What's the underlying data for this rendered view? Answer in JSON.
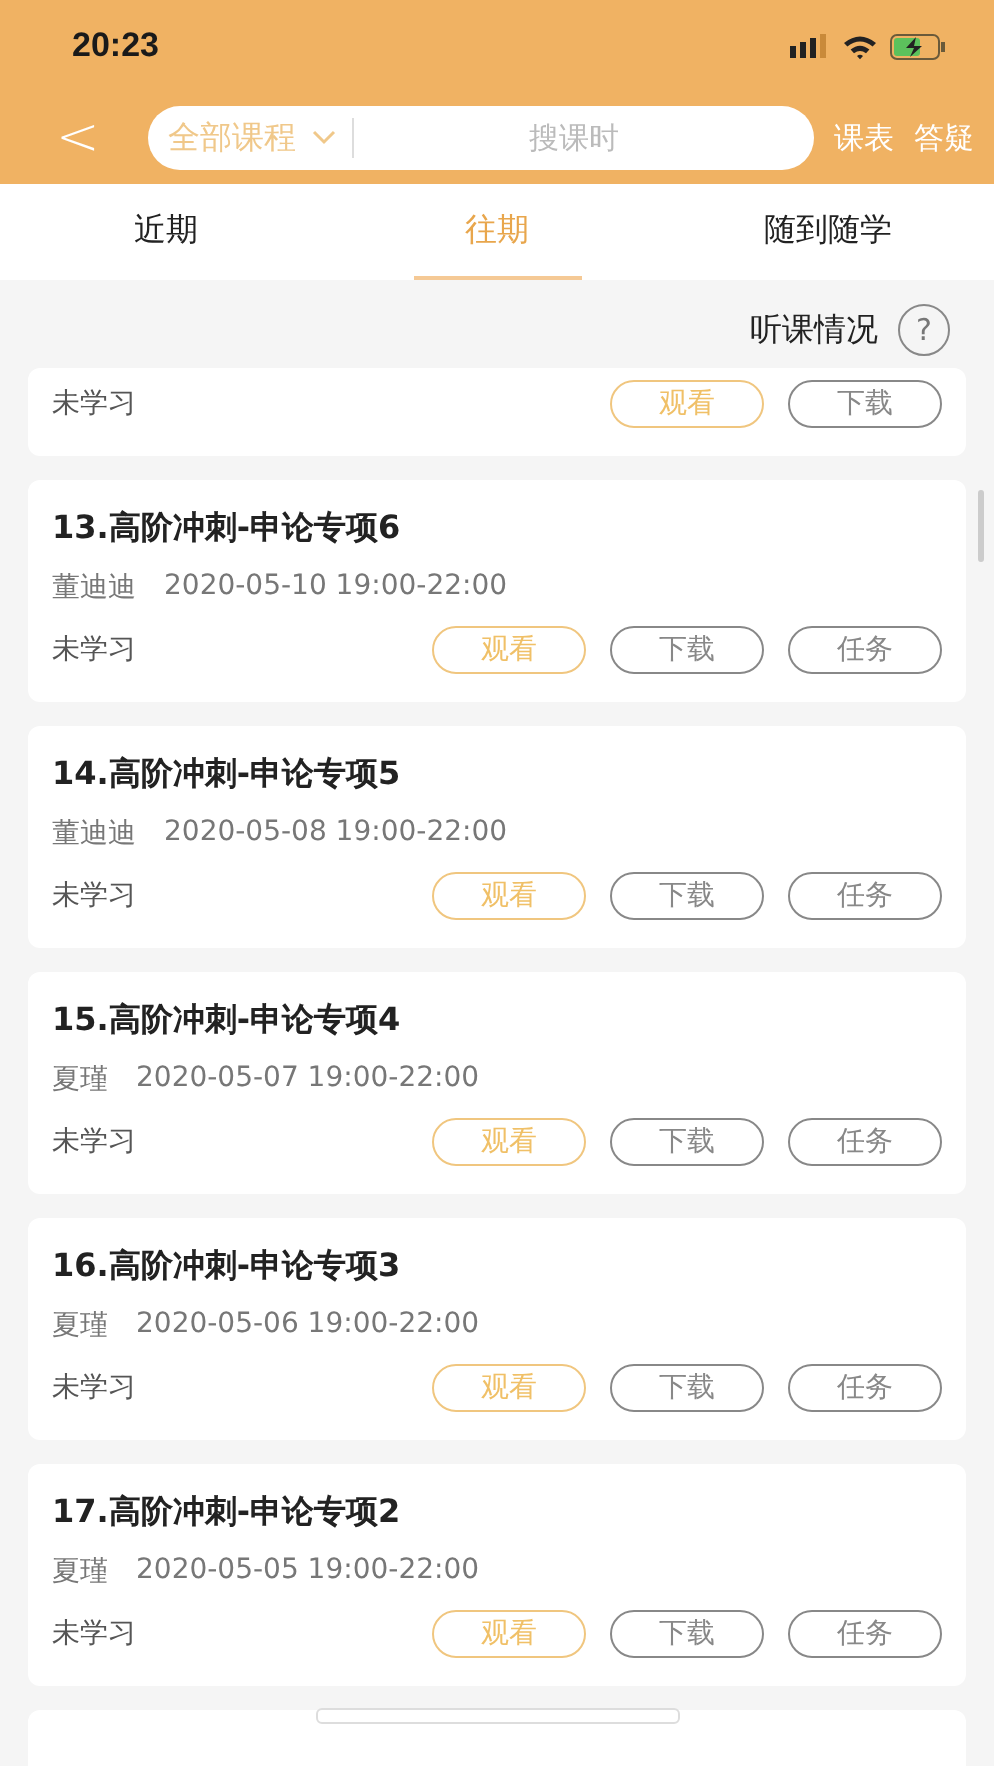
{
  "status_bar": {
    "time": "20:23"
  },
  "nav": {
    "back": "<",
    "course_filter": "全部课程",
    "search": {
      "placeholder": "搜课时"
    },
    "links": [
      "课表",
      "答疑"
    ]
  },
  "tabs": [
    {
      "label": "近期",
      "selected": false
    },
    {
      "label": "往期",
      "selected": true
    },
    {
      "label": "随到随学",
      "selected": false
    }
  ],
  "attendance": {
    "label": "听课情况",
    "help": "?"
  },
  "lessons": [
    {
      "status": "未学习",
      "buttons": [
        {
          "label": "观看",
          "kind": "primary"
        },
        {
          "label": "下载",
          "kind": "plain"
        }
      ]
    },
    {
      "title": "13.高阶冲刺-申论专项6",
      "teacher": "董迪迪",
      "time": "2020-05-10 19:00-22:00",
      "status": "未学习",
      "buttons": [
        {
          "label": "观看",
          "kind": "primary"
        },
        {
          "label": "下载",
          "kind": "plain"
        },
        {
          "label": "任务",
          "kind": "plain"
        }
      ]
    },
    {
      "title": "14.高阶冲刺-申论专项5",
      "teacher": "董迪迪",
      "time": "2020-05-08 19:00-22:00",
      "status": "未学习",
      "buttons": [
        {
          "label": "观看",
          "kind": "primary"
        },
        {
          "label": "下载",
          "kind": "plain"
        },
        {
          "label": "任务",
          "kind": "plain"
        }
      ]
    },
    {
      "title": "15.高阶冲刺-申论专项4",
      "teacher": "夏瑾",
      "time": "2020-05-07 19:00-22:00",
      "status": "未学习",
      "buttons": [
        {
          "label": "观看",
          "kind": "primary"
        },
        {
          "label": "下载",
          "kind": "plain"
        },
        {
          "label": "任务",
          "kind": "plain"
        }
      ]
    },
    {
      "title": "16.高阶冲刺-申论专项3",
      "teacher": "夏瑾",
      "time": "2020-05-06 19:00-22:00",
      "status": "未学习",
      "buttons": [
        {
          "label": "观看",
          "kind": "primary"
        },
        {
          "label": "下载",
          "kind": "plain"
        },
        {
          "label": "任务",
          "kind": "plain"
        }
      ]
    },
    {
      "title": "17.高阶冲刺-申论专项2",
      "teacher": "夏瑾",
      "time": "2020-05-05 19:00-22:00",
      "status": "未学习",
      "buttons": [
        {
          "label": "观看",
          "kind": "primary"
        },
        {
          "label": "下载",
          "kind": "plain"
        },
        {
          "label": "任务",
          "kind": "plain"
        }
      ]
    }
  ]
}
